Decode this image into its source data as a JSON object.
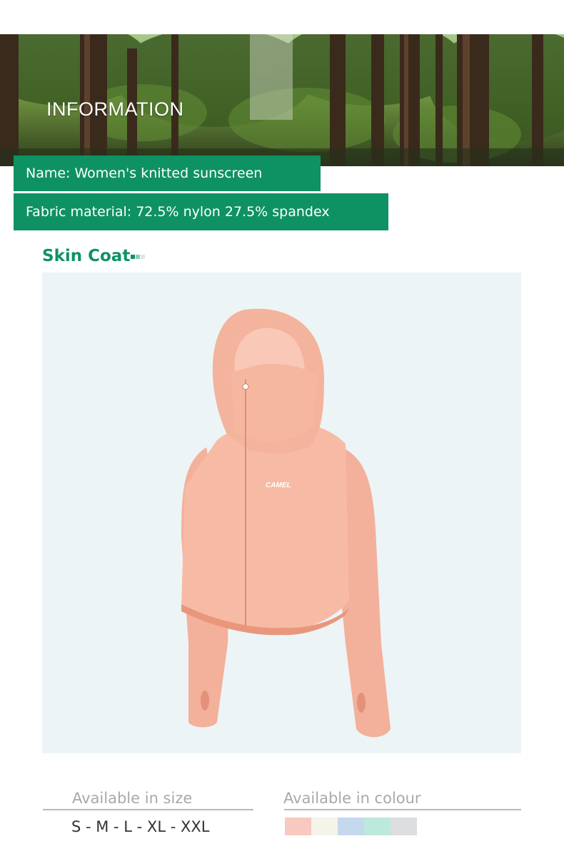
{
  "banner": {
    "title": "INFORMATION"
  },
  "tags": {
    "name": "Name: Women's knitted sunscreen",
    "fabric": "Fabric material: 72.5% nylon 27.5% spandex"
  },
  "section": {
    "title": "Skin Coat"
  },
  "product": {
    "brand_print": "CAMEL",
    "image_icon": "jacket-icon",
    "jacket_color": "#f4b9a4"
  },
  "availability": {
    "size_label": "Available in size",
    "sizes": "S - M - L - XL - XXL",
    "colour_label": "Available in colour",
    "colours": [
      "#f7c9c0",
      "#f4f4e8",
      "#c5d9ee",
      "#bde8dc",
      "#dcdedf"
    ]
  },
  "theme": {
    "accent": "#0f9263"
  }
}
